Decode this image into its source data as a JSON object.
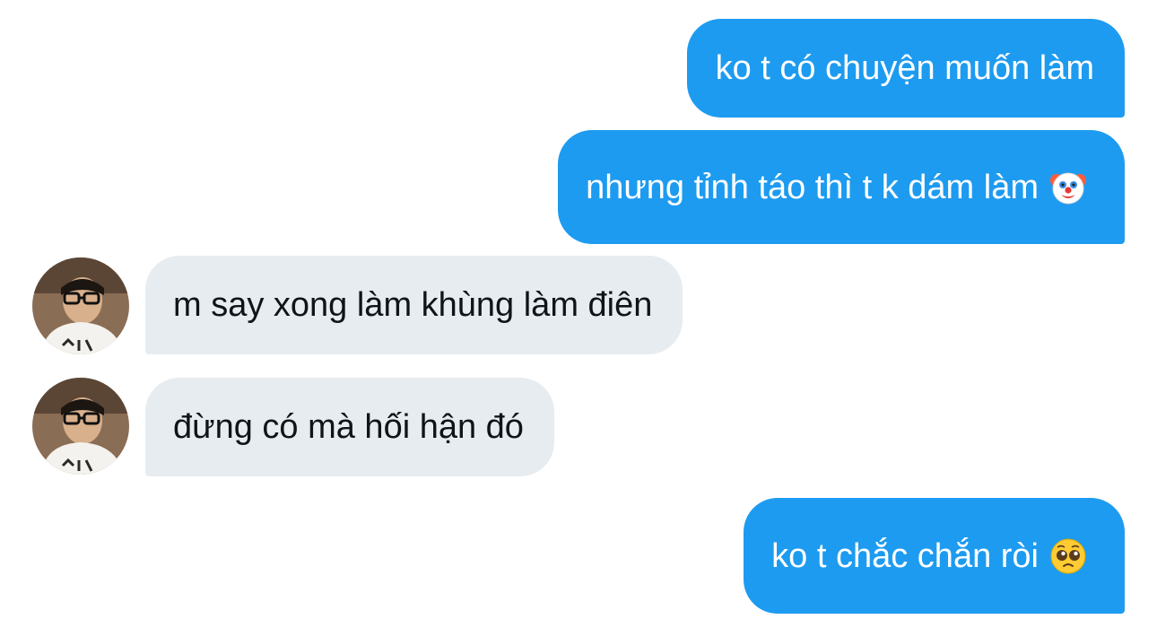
{
  "conversation": {
    "messages": [
      {
        "direction": "sent",
        "text": "ko t có chuyện muốn làm"
      },
      {
        "direction": "sent",
        "text": "nhưng tỉnh táo thì t k dám làm",
        "emoji": "clown-face-emoji"
      },
      {
        "direction": "received",
        "text": "m say xong làm khùng làm điên",
        "avatar": "user-avatar"
      },
      {
        "direction": "received",
        "text": "đừng có mà hối hận đó",
        "avatar": "user-avatar"
      },
      {
        "direction": "sent",
        "text": "ko t chắc chắn ròi",
        "emoji": "pleading-face-emoji"
      }
    ]
  },
  "colors": {
    "sent_bubble": "#1d9bf0",
    "sent_text": "#ffffff",
    "received_bubble": "#e7ecf0",
    "received_text": "#0f1419"
  }
}
